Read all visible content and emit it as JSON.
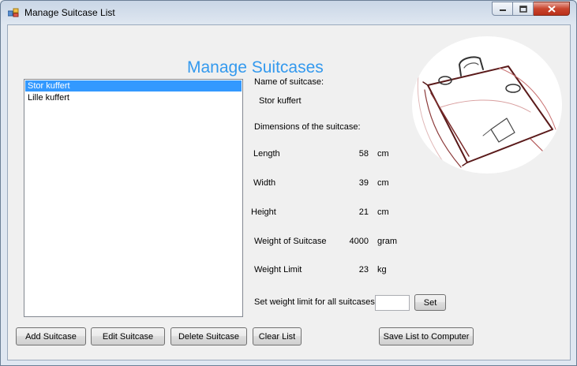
{
  "window": {
    "title": "Manage Suitcase List"
  },
  "heading": "Manage Suitcases",
  "suitcase_list": {
    "items": [
      "Stor kuffert",
      "Lille kuffert"
    ],
    "selected_index": 0
  },
  "details": {
    "name_label": "Name of suitcase:",
    "name_value": "Stor kuffert",
    "dimensions_label": "Dimensions of the suitcase:",
    "length": {
      "label": "Length",
      "value": "58",
      "unit": "cm"
    },
    "width": {
      "label": "Width",
      "value": "39",
      "unit": "cm"
    },
    "height": {
      "label": "Height",
      "value": "21",
      "unit": "cm"
    },
    "weight": {
      "label": "Weight of Suitcase",
      "value": "4000",
      "unit": "gram"
    },
    "weight_limit": {
      "label": "Weight Limit",
      "value": "23",
      "unit": "kg"
    }
  },
  "set_all": {
    "label": "Set weight limit for all suitcases",
    "value": "",
    "button": "Set"
  },
  "buttons": {
    "add": "Add Suitcase",
    "edit": "Edit Suitcase",
    "delete": "Delete Suitcase",
    "clear": "Clear List",
    "save": "Save List to Computer"
  },
  "icons": {
    "app": "app-icon",
    "minimize": "minimize-icon",
    "maximize": "maximize-icon",
    "close": "close-icon",
    "picture": "suitcase-sketch"
  },
  "colors": {
    "heading": "#3399ee",
    "selection": "#3399ff",
    "close_button": "#c9452e"
  }
}
